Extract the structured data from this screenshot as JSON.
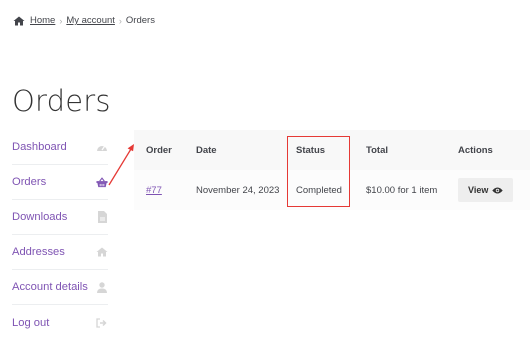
{
  "breadcrumb": {
    "home": "Home",
    "separator": "›",
    "account": "My account",
    "current": "Orders"
  },
  "page_title": "Orders",
  "nav": {
    "items": [
      {
        "label": "Dashboard",
        "icon": "dashboard-icon"
      },
      {
        "label": "Orders",
        "icon": "basket-icon",
        "active": true
      },
      {
        "label": "Downloads",
        "icon": "file-icon"
      },
      {
        "label": "Addresses",
        "icon": "home-icon"
      },
      {
        "label": "Account details",
        "icon": "user-icon"
      },
      {
        "label": "Log out",
        "icon": "logout-icon"
      }
    ]
  },
  "table": {
    "headers": {
      "order": "Order",
      "date": "Date",
      "status": "Status",
      "total": "Total",
      "actions": "Actions"
    },
    "rows": [
      {
        "order": "#77",
        "date": "November 24, 2023",
        "status": "Completed",
        "total": "$10.00 for 1 item",
        "action": "View"
      }
    ]
  },
  "colors": {
    "link": "#7f54b3",
    "annotation": "#e53935"
  }
}
